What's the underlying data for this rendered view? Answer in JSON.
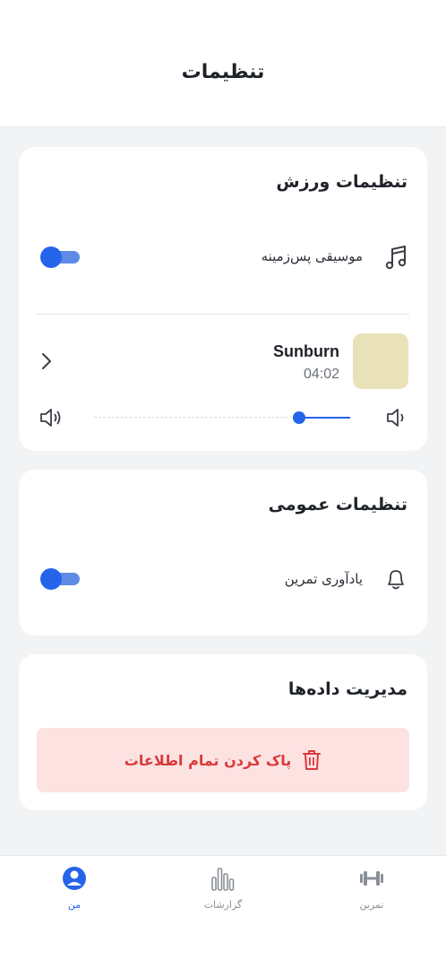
{
  "header": {
    "title": "تنظیمات"
  },
  "workout_settings": {
    "title": "تنظیمات ورزش",
    "background_music": {
      "label": "موسیقی پس‌زمینه",
      "icon": "music-note-icon",
      "enabled": true
    },
    "track": {
      "title": "Sunburn",
      "duration": "04:02"
    },
    "volume": {
      "level": 0.2
    }
  },
  "general_settings": {
    "title": "تنظیمات عمومی",
    "workout_reminder": {
      "label": "یادآوری تمرین",
      "icon": "bell-icon",
      "enabled": true
    }
  },
  "data_management": {
    "title": "مدیریت داده‌ها",
    "clear_button": {
      "label": "پاک کردن تمام اطلاعات",
      "icon": "trash-icon"
    }
  },
  "bottom_nav": {
    "items": [
      {
        "label": "من",
        "icon": "profile-icon",
        "active": true
      },
      {
        "label": "گزارشات",
        "icon": "bar-chart-icon",
        "active": false
      },
      {
        "label": "تمرین",
        "icon": "dumbbell-icon",
        "active": false
      }
    ]
  },
  "colors": {
    "accent": "#2563eb",
    "danger": "#d93a3a",
    "danger_bg": "#fde2e2",
    "album_art": "#e9e1b8"
  }
}
